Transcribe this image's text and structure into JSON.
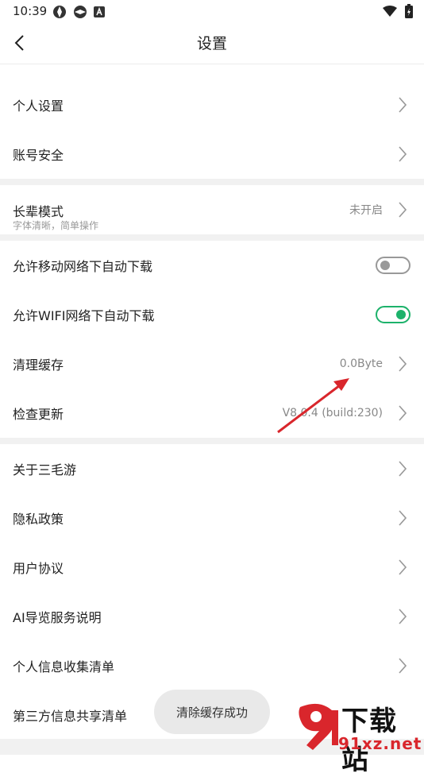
{
  "status_bar": {
    "time": "10:39",
    "icons_left": [
      "app-icon",
      "app-icon",
      "a-badge-icon"
    ],
    "icons_right": [
      "wifi-icon",
      "battery-icon"
    ]
  },
  "header": {
    "title": "设置"
  },
  "groups": {
    "g1": [
      {
        "label": "个人设置"
      },
      {
        "label": "账号安全"
      }
    ],
    "elder": {
      "label": "长辈模式",
      "sub": "字体清晰，简单操作",
      "value": "未开启"
    },
    "g3": {
      "mobile_download": {
        "label": "允许移动网络下自动下载",
        "on": false
      },
      "wifi_download": {
        "label": "允许WIFI网络下自动下载",
        "on": true
      },
      "clear_cache": {
        "label": "清理缓存",
        "value": "0.0Byte"
      },
      "check_update": {
        "label": "检查更新",
        "value": "V8.0.4 (build:230)"
      }
    },
    "g4": [
      {
        "label": "关于三毛游"
      },
      {
        "label": "隐私政策"
      },
      {
        "label": "用户协议"
      },
      {
        "label": "AI导览服务说明"
      },
      {
        "label": "个人信息收集清单"
      },
      {
        "label": "第三方信息共享清单"
      }
    ]
  },
  "toast": {
    "text": "清除缓存成功"
  },
  "watermark": {
    "text": "下载站",
    "url": "91xz.net"
  },
  "colors": {
    "accent_green": "#1db26b",
    "annotation_red": "#d9262c"
  }
}
